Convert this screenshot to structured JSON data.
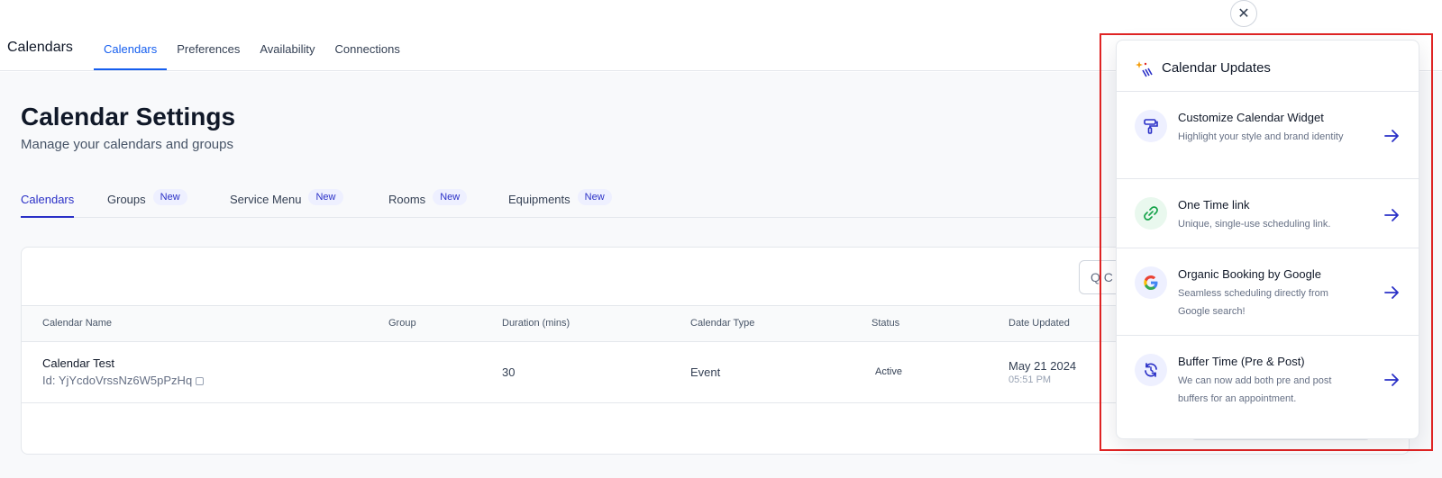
{
  "app": {
    "title": "Calendars"
  },
  "topnav": {
    "items": [
      {
        "label": "Calendars",
        "active": true
      },
      {
        "label": "Preferences",
        "active": false
      },
      {
        "label": "Availability",
        "active": false
      },
      {
        "label": "Connections",
        "active": false
      }
    ]
  },
  "close_icon": "close-icon",
  "page": {
    "title": "Calendar Settings",
    "subtitle": "Manage your calendars and groups"
  },
  "tabs": [
    {
      "label": "Calendars",
      "badge": "",
      "active": true
    },
    {
      "label": "Groups",
      "badge": "New",
      "active": false
    },
    {
      "label": "Service Menu",
      "badge": "New",
      "active": false
    },
    {
      "label": "Rooms",
      "badge": "New",
      "active": false
    },
    {
      "label": "Equipments",
      "badge": "New",
      "active": false
    }
  ],
  "search": {
    "partial_text": "Q C"
  },
  "table": {
    "columns": [
      "Calendar Name",
      "Group",
      "Duration (mins)",
      "Calendar Type",
      "Status",
      "Date Updated"
    ],
    "rows": [
      {
        "name": "Calendar Test",
        "id_text": "Id: YjYcdoVrssNz6W5pPzHq",
        "group": "",
        "duration": "30",
        "type": "Event",
        "status": "Active",
        "date": "May 21 2024",
        "time": "05:51 PM"
      }
    ]
  },
  "updates_panel": {
    "title": "Calendar Updates",
    "items": [
      {
        "title": "Customize Calendar Widget",
        "description": "Highlight your style and brand identity",
        "icon": "paint-roller-icon",
        "icon_bg": "#eef0ff",
        "icon_color": "#2a30c7"
      },
      {
        "title": "One Time link",
        "description": "Unique, single-use scheduling link.",
        "icon": "link-icon",
        "icon_bg": "#e9f8ee",
        "icon_color": "#16a34a"
      },
      {
        "title": "Organic Booking by Google",
        "description": "Seamless scheduling directly from Google search!",
        "icon": "google-icon",
        "icon_bg": "#eef0ff",
        "icon_color": "#4285f4"
      },
      {
        "title": "Buffer Time (Pre & Post)",
        "description": "We can now add both pre and post buffers for an appointment.",
        "icon": "refresh-clock-icon",
        "icon_bg": "#eef0ff",
        "icon_color": "#2a30c7"
      }
    ]
  },
  "colors": {
    "accent": "#155eef",
    "tab_accent": "#2a30c7",
    "highlight_border": "#e02424"
  }
}
